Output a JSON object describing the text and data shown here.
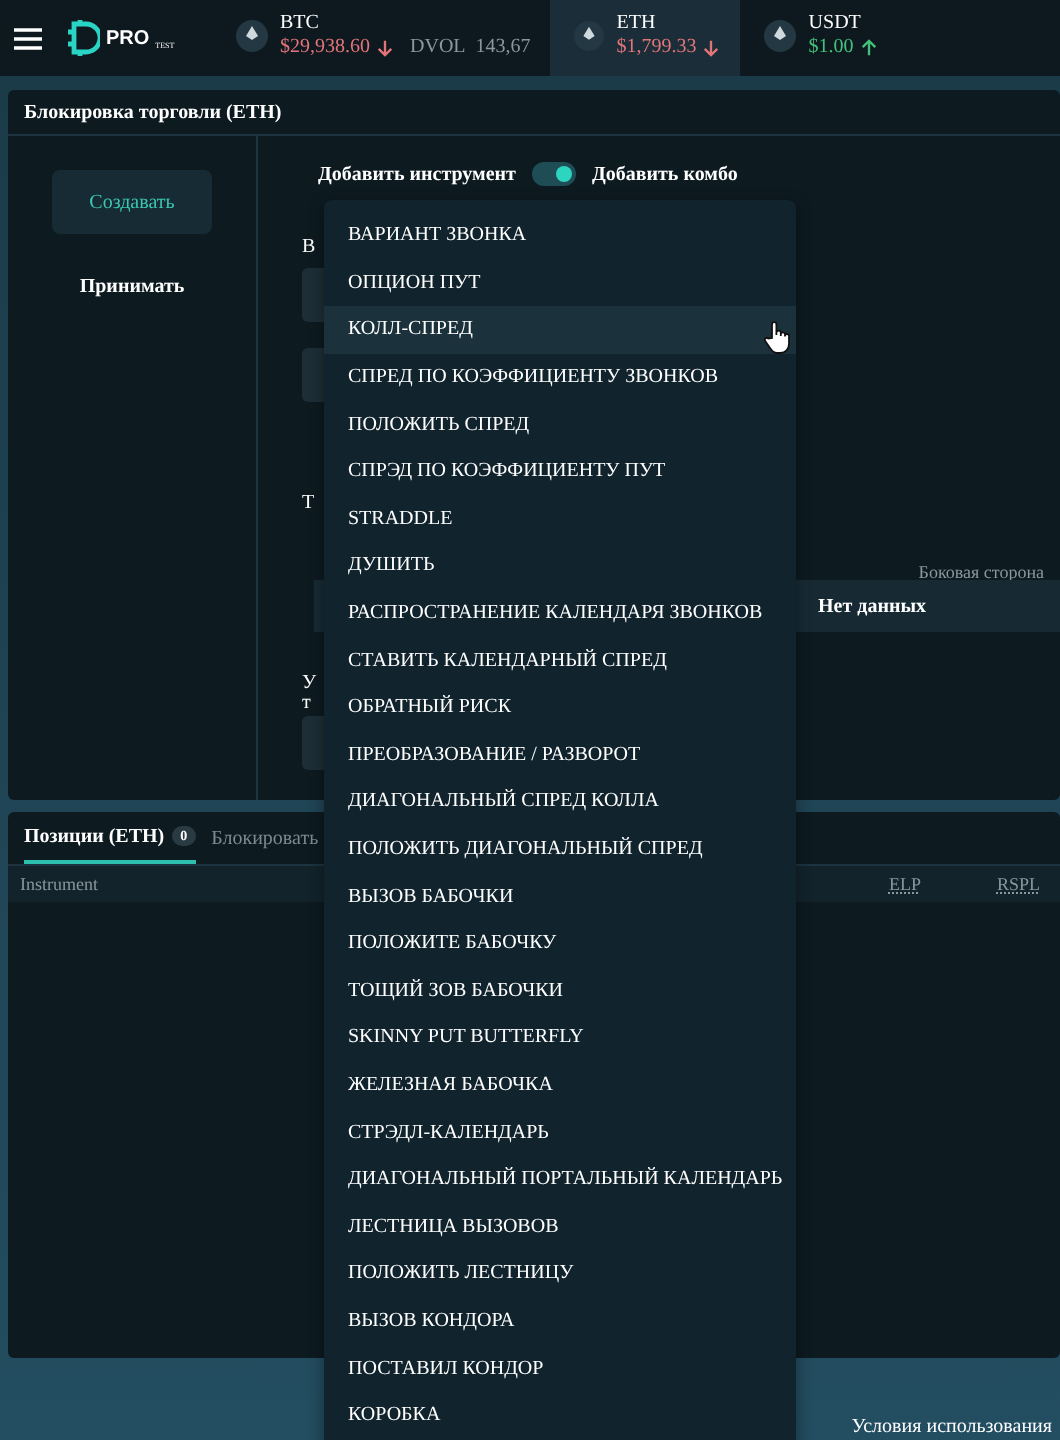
{
  "topbar": {
    "logo": "PRO",
    "logo_badge": "TEST",
    "tickers": [
      {
        "symbol": "BTC",
        "price": "$29,938.60",
        "falling": true,
        "extra_label": "DVOL",
        "extra_value": "143,67",
        "selected": false
      },
      {
        "symbol": "ETH",
        "price": "$1,799.33",
        "falling": true,
        "selected": true
      },
      {
        "symbol": "USDT",
        "price": "$1.00",
        "falling": false,
        "selected": false
      }
    ]
  },
  "trade_panel": {
    "title": "Блокировка торговли  (ETH)",
    "side_menu": [
      {
        "label": "Создавать",
        "selected": true
      },
      {
        "label": "Принимать",
        "selected": false
      }
    ],
    "toggle": {
      "left_label": "Добавить инструмент",
      "right_label": "Добавить комбо",
      "on": true
    },
    "partial_labels": [
      "В",
      "Т",
      "У",
      "т"
    ],
    "side_label": "Боковая сторона",
    "empty_text": "Нет данных"
  },
  "positions_panel": {
    "tabs": [
      {
        "label": "Позиции  (ETH)",
        "count": "0",
        "selected": true
      },
      {
        "label": "Блокировать",
        "selected": false
      }
    ],
    "columns": [
      "Instrument",
      "ELP",
      "RSPL"
    ]
  },
  "dropdown": {
    "items": [
      {
        "label": "ВАРИАНТ ЗВОНКА",
        "hovered": false
      },
      {
        "label": "ОПЦИОН ПУТ",
        "hovered": false
      },
      {
        "label": "КОЛЛ-СПРЕД",
        "hovered": true
      },
      {
        "label": "СПРЕД ПО КОЭФФИЦИЕНТУ ЗВОНКОВ",
        "hovered": false
      },
      {
        "label": "ПОЛОЖИТЬ СПРЕД",
        "hovered": false
      },
      {
        "label": "СПРЭД ПО КОЭФФИЦИЕНТУ ПУТ",
        "hovered": false
      },
      {
        "label": "STRADDLE",
        "hovered": false
      },
      {
        "label": "ДУШИТЬ",
        "hovered": false
      },
      {
        "label": "РАСПРОСТРАНЕНИЕ КАЛЕНДАРЯ ЗВОНКОВ",
        "hovered": false
      },
      {
        "label": "СТАВИТЬ КАЛЕНДАРНЫЙ СПРЕД",
        "hovered": false
      },
      {
        "label": "ОБРАТНЫЙ РИСК",
        "hovered": false
      },
      {
        "label": "ПРЕОБРАЗОВАНИЕ / РАЗВОРОТ",
        "hovered": false
      },
      {
        "label": "ДИАГОНАЛЬНЫЙ СПРЕД КОЛЛА",
        "hovered": false
      },
      {
        "label": "ПОЛОЖИТЬ ДИАГОНАЛЬНЫЙ СПРЕД",
        "hovered": false
      },
      {
        "label": "ВЫЗОВ БАБОЧКИ",
        "hovered": false
      },
      {
        "label": "ПОЛОЖИТЕ БАБОЧКУ",
        "hovered": false
      },
      {
        "label": "ТОЩИЙ ЗОВ БАБОЧКИ",
        "hovered": false
      },
      {
        "label": "SKINNY PUT BUTTERFLY",
        "hovered": false
      },
      {
        "label": "ЖЕЛЕЗНАЯ БАБОЧКА",
        "hovered": false
      },
      {
        "label": "СТРЭДЛ-КАЛЕНДАРЬ",
        "hovered": false
      },
      {
        "label": "ДИАГОНАЛЬНЫЙ ПОРТАЛЬНЫЙ КАЛЕНДАРЬ",
        "hovered": false
      },
      {
        "label": "ЛЕСТНИЦА ВЫЗОВОВ",
        "hovered": false
      },
      {
        "label": "ПОЛОЖИТЬ ЛЕСТНИЦУ",
        "hovered": false
      },
      {
        "label": "ВЫЗОВ КОНДОРА",
        "hovered": false
      },
      {
        "label": "ПОСТАВИЛ КОНДОР",
        "hovered": false
      },
      {
        "label": "КОРОБКА",
        "hovered": false
      }
    ]
  },
  "footer": {
    "link": "Условия использования"
  }
}
